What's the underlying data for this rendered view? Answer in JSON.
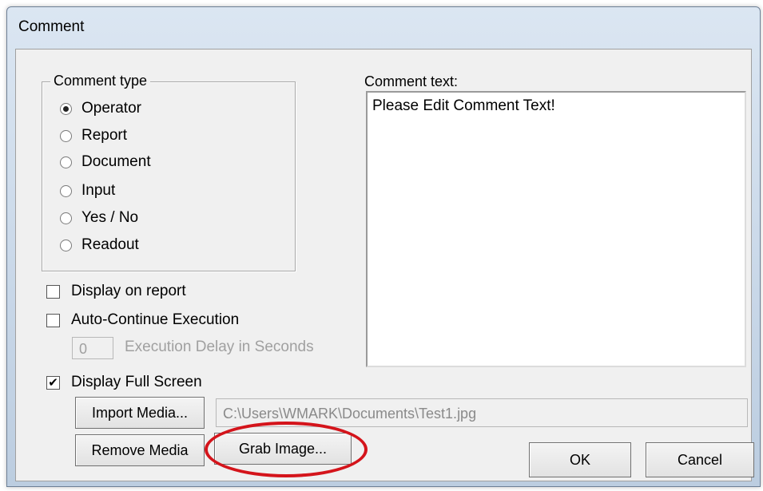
{
  "window": {
    "title": "Comment"
  },
  "comment_type": {
    "legend": "Comment type",
    "options": [
      {
        "label": "Operator",
        "selected": true
      },
      {
        "label": "Report",
        "selected": false
      },
      {
        "label": "Document",
        "selected": false
      },
      {
        "label": "Input",
        "selected": false
      },
      {
        "label": "Yes / No",
        "selected": false
      },
      {
        "label": "Readout",
        "selected": false
      }
    ]
  },
  "options": {
    "display_on_report": {
      "label": "Display on report",
      "checked": false
    },
    "auto_continue": {
      "label": "Auto-Continue Execution",
      "checked": false
    },
    "delay_value": "0",
    "delay_label": "Execution Delay in Seconds",
    "display_full_screen": {
      "label": "Display Full Screen",
      "checked": true,
      "mark": "✔"
    }
  },
  "comment_text": {
    "label": "Comment text:",
    "value": "Please Edit Comment Text!"
  },
  "media": {
    "import_label": "Import Media...",
    "remove_label": "Remove Media",
    "grab_label": "Grab Image...",
    "path": "C:\\Users\\WMARK\\Documents\\Test1.jpg"
  },
  "dialog_buttons": {
    "ok_label": "OK",
    "cancel_label": "Cancel"
  },
  "annotation": {
    "highlight_color": "#d4141b"
  }
}
